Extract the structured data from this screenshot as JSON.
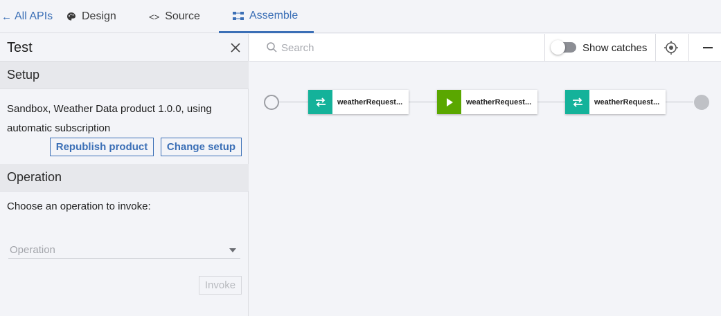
{
  "nav": {
    "back_label": "All APIs",
    "tabs": [
      {
        "label": "Design",
        "icon": "palette-icon"
      },
      {
        "label": "Source",
        "icon": "code-icon"
      },
      {
        "label": "Assemble",
        "icon": "assemble-icon",
        "active": true
      }
    ]
  },
  "test_panel": {
    "title": "Test",
    "setup": {
      "heading": "Setup",
      "description": "Sandbox, Weather Data product 1.0.0, using automatic subscription",
      "republish_label": "Republish product",
      "change_setup_label": "Change setup"
    },
    "operation": {
      "heading": "Operation",
      "prompt": "Choose an operation to invoke:",
      "select_placeholder": "Operation",
      "invoke_label": "Invoke"
    }
  },
  "toolbar": {
    "search_placeholder": "Search",
    "show_catches_label": "Show catches",
    "show_catches_on": false
  },
  "flow": {
    "policies": [
      {
        "label": "weatherRequest...",
        "type": "map",
        "icon": "swap-arrows-icon",
        "color": "#14b29a"
      },
      {
        "label": "weatherRequest...",
        "type": "invoke",
        "icon": "play-icon",
        "color": "#5aa700"
      },
      {
        "label": "weatherRequest...",
        "type": "map",
        "icon": "swap-arrows-icon",
        "color": "#14b29a"
      }
    ]
  },
  "colors": {
    "accent": "#3b6fb6",
    "map_policy": "#14b29a",
    "invoke_policy": "#5aa700"
  }
}
